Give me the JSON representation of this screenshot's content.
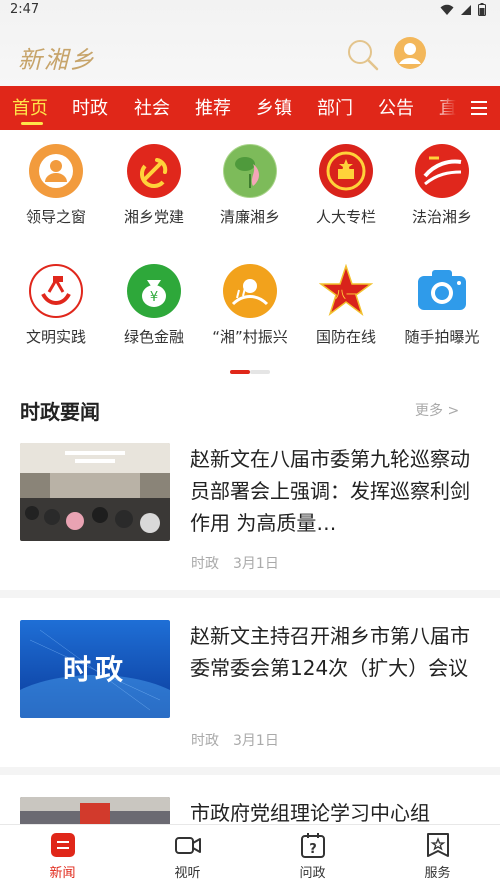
{
  "status_bar": {
    "time": "2:47"
  },
  "header": {
    "logo_text": "新湘乡"
  },
  "tabs": [
    {
      "label": "首页",
      "active": true
    },
    {
      "label": "时政"
    },
    {
      "label": "社会"
    },
    {
      "label": "推荐"
    },
    {
      "label": "乡镇"
    },
    {
      "label": "部门"
    },
    {
      "label": "公告"
    },
    {
      "label": "直"
    }
  ],
  "grid": [
    {
      "label": "领导之窗",
      "icon": "leader-icon",
      "color": "#f29b3d"
    },
    {
      "label": "湘乡党建",
      "icon": "party-emblem-icon",
      "color": "#e0271c"
    },
    {
      "label": "清廉湘乡",
      "icon": "lotus-icon",
      "color": "#7dbb5a"
    },
    {
      "label": "人大专栏",
      "icon": "national-emblem-icon",
      "color": "#d9231b"
    },
    {
      "label": "法治湘乡",
      "icon": "rule-of-law-icon",
      "color": "#e0271c"
    },
    {
      "label": "文明实践",
      "icon": "civilization-icon",
      "color": "#e0271c"
    },
    {
      "label": "绿色金融",
      "icon": "money-bag-icon",
      "color": "#2ea83a"
    },
    {
      "label": "“湘”村振兴",
      "icon": "rural-icon",
      "color": "#f2a21c"
    },
    {
      "label": "国防在线",
      "icon": "army-star-icon",
      "color": "#d9231b"
    },
    {
      "label": "随手拍曝光",
      "icon": "camera-icon",
      "color": "#2f9bea"
    }
  ],
  "section": {
    "title": "时政要闻",
    "more": "更多 >"
  },
  "news": [
    {
      "title": "赵新文在八届市委第九轮巡察动员部署会上强调：发挥巡察利剑作用 为高质量…",
      "category": "时政",
      "date": "3月1日",
      "thumb": "meeting-hall-photo"
    },
    {
      "title": "赵新文主持召开湘乡市第八届市委常委会第124次（扩大）会议",
      "category": "时政",
      "date": "3月1日",
      "thumb": "shizheng-banner",
      "thumb_text": "时政"
    },
    {
      "title": "市政府党组理论学习中心组",
      "thumb": "meeting-photo"
    }
  ],
  "bottom_nav": [
    {
      "label": "新闻",
      "active": true
    },
    {
      "label": "视听"
    },
    {
      "label": "问政"
    },
    {
      "label": "服务"
    }
  ],
  "colors": {
    "brand_red": "#e02719",
    "active_tab": "#ffe54a"
  }
}
